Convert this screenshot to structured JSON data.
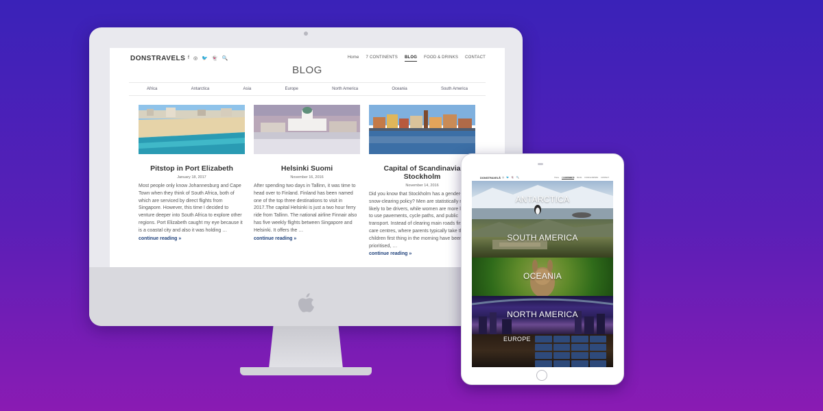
{
  "desktop": {
    "brand": "DONSTRAVELS",
    "social_icons": [
      "facebook-icon",
      "instagram-icon",
      "twitter-icon",
      "snapchat-icon",
      "search-icon"
    ],
    "social_glyphs": [
      "f",
      "◎",
      "🐦",
      "👻",
      "🔍"
    ],
    "nav": [
      "Home",
      "7 CONTINENTS",
      "BLOG",
      "FOOD & DRINKS",
      "CONTACT"
    ],
    "nav_active": "BLOG",
    "page_title": "BLOG",
    "categories": [
      "Africa",
      "Antarctica",
      "Asia",
      "Europe",
      "North America",
      "Oceania",
      "South America"
    ],
    "posts": [
      {
        "title": "Pitstop in Port Elizabeth",
        "date": "January 18, 2017",
        "excerpt": "Most people only know Johannesburg and Cape Town when they think of South Africa, both of which are serviced by direct flights from Singapore. However, this time I decided to venture deeper into South Africa to explore other regions. Port Elizabeth caught my eye because it is a coastal city and also it was holding …",
        "more": "continue reading »"
      },
      {
        "title": "Helsinki Suomi",
        "date": "November 16, 2016",
        "excerpt": "After spending two days in Tallinn, it was time to head over to Finland. Finland has been named one of the top three destinations to visit in 2017.The capital Helsinki is just a two hour ferry ride from Tallinn. The national airline Finnair also has five weekly flights between Singapore and Helsinki. It offers the …",
        "more": "continue reading »"
      },
      {
        "title": "Capital of Scandinavia Stockholm",
        "date": "November 14, 2016",
        "excerpt": "Did you know that Stockholm has a gender-equal snow-clearing policy? Men are statistically more likely to be drivers, while women are more likely to use pavements, cycle paths, and public transport. Instead of clearing main roads first, day care centres, where parents typically take their children first thing in the morning have been prioritised, …",
        "more": "continue reading »"
      }
    ]
  },
  "tablet": {
    "brand": "DONSTRAVELS",
    "icons": "f ◎ 🐦 👻 🔍",
    "nav": [
      "Home",
      "7 CONTINENTS",
      "BLOG",
      "FOOD & DRINKS",
      "CONTACT"
    ],
    "nav_active": "7 CONTINENTS",
    "banners": [
      "ANTARCTICA",
      "SOUTH AMERICA",
      "OCEANIA",
      "NORTH AMERICA",
      "EUROPE"
    ]
  },
  "colors": {
    "background_top": "#3a22b8",
    "background_bottom": "#8a1bb3",
    "link": "#1c3f7a"
  }
}
